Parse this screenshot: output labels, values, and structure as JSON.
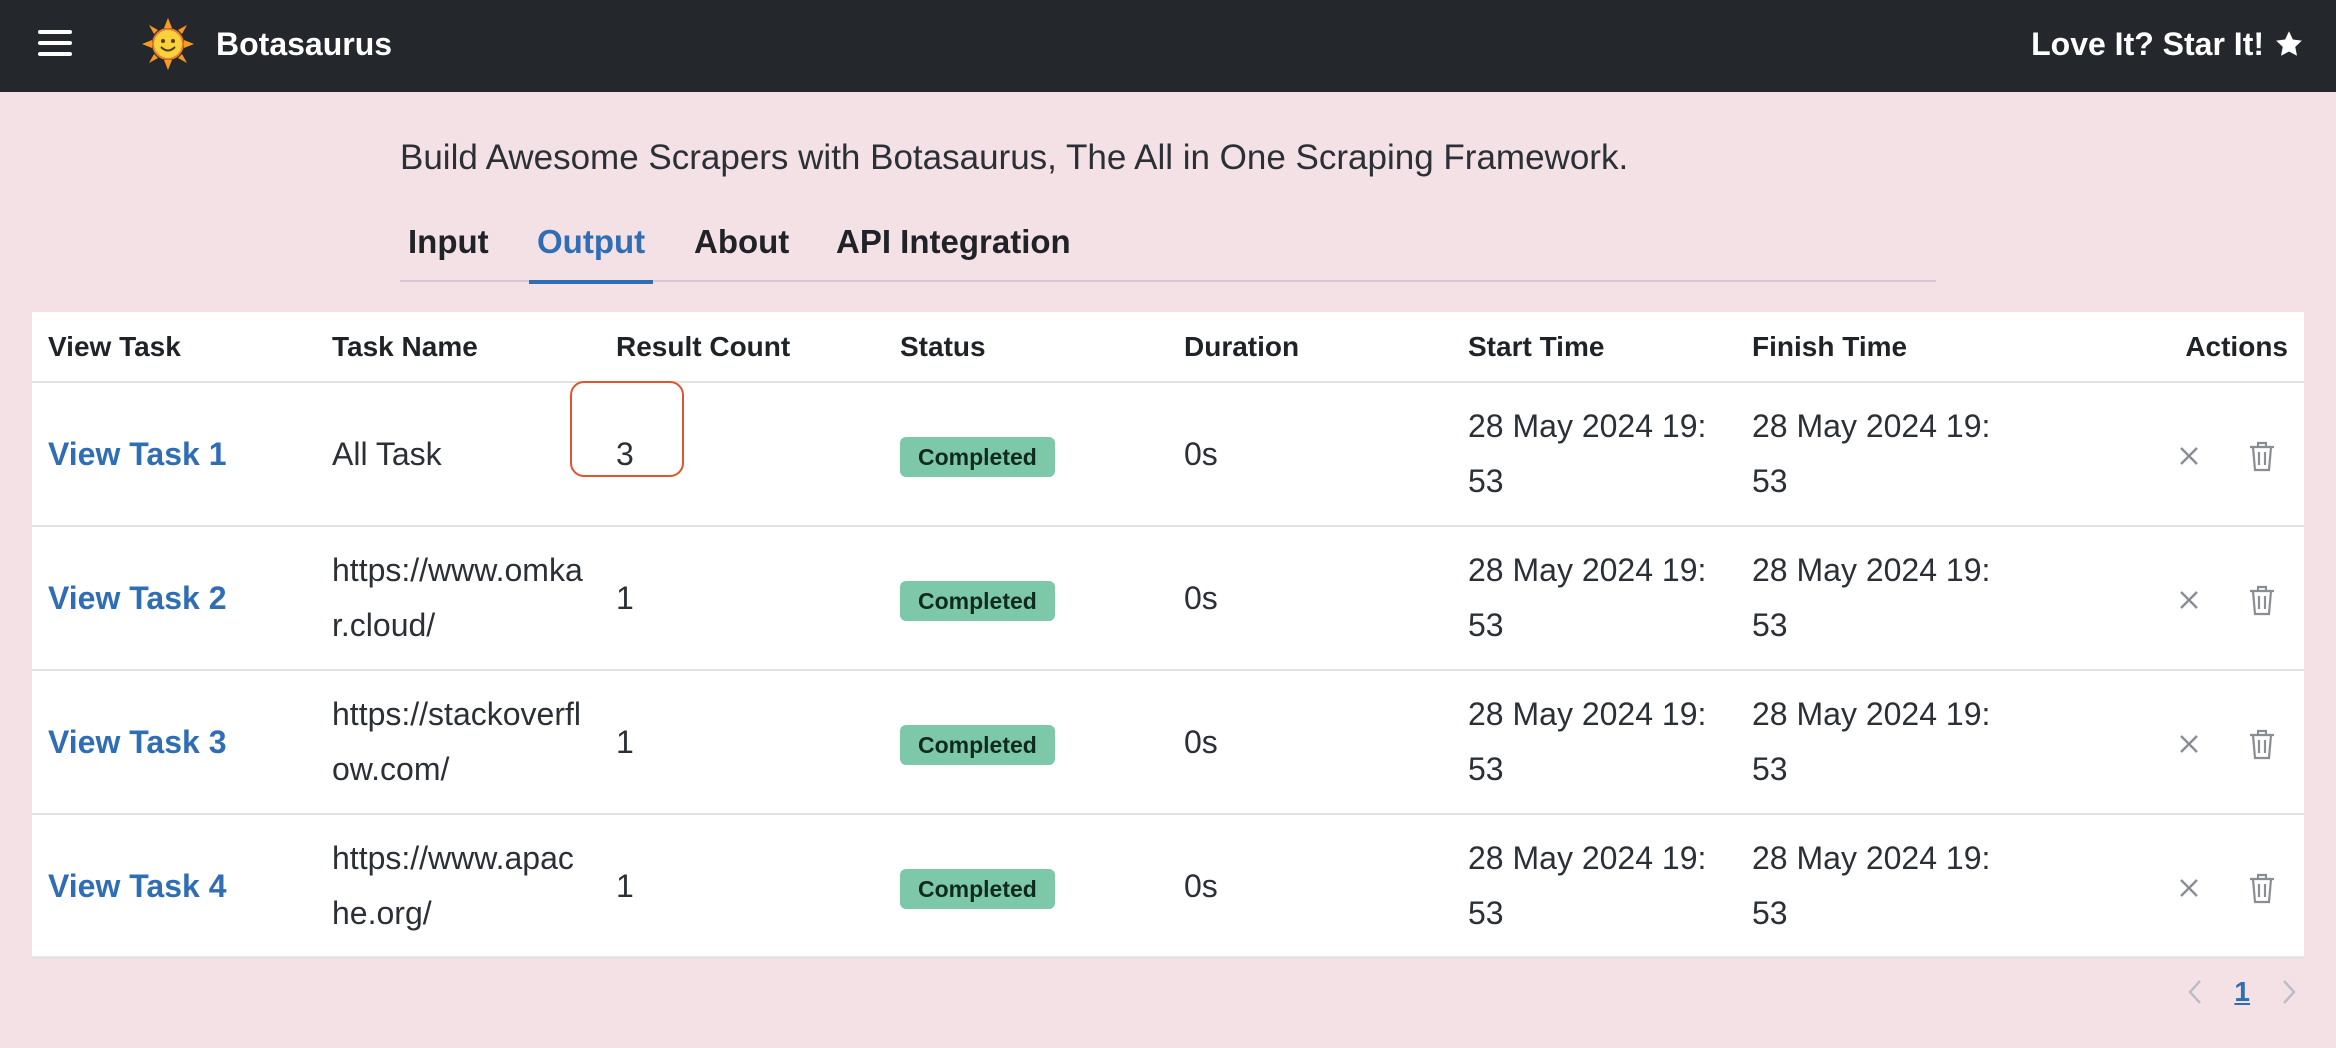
{
  "header": {
    "brand": "Botasaurus",
    "cta": "Love It? Star It!"
  },
  "tagline": "Build Awesome Scrapers with Botasaurus, The All in One Scraping Framework.",
  "tabs": [
    {
      "label": "Input",
      "active": false
    },
    {
      "label": "Output",
      "active": true
    },
    {
      "label": "About",
      "active": false
    },
    {
      "label": "API Integration",
      "active": false
    }
  ],
  "table": {
    "columns": [
      "View Task",
      "Task Name",
      "Result Count",
      "Status",
      "Duration",
      "Start Time",
      "Finish Time",
      "Actions"
    ],
    "rows": [
      {
        "view": "View Task 1",
        "name": "All Task",
        "count": "3",
        "status": "Completed",
        "duration": "0s",
        "start": "28 May 2024 19:53",
        "finish": "28 May 2024 19:53"
      },
      {
        "view": "View Task 2",
        "name": "https://www.omkar.cloud/",
        "count": "1",
        "status": "Completed",
        "duration": "0s",
        "start": "28 May 2024 19:53",
        "finish": "28 May 2024 19:53"
      },
      {
        "view": "View Task 3",
        "name": "https://stackoverflow.com/",
        "count": "1",
        "status": "Completed",
        "duration": "0s",
        "start": "28 May 2024 19:53",
        "finish": "28 May 2024 19:53"
      },
      {
        "view": "View Task 4",
        "name": "https://www.apache.org/",
        "count": "1",
        "status": "Completed",
        "duration": "0s",
        "start": "28 May 2024 19:53",
        "finish": "28 May 2024 19:53"
      }
    ]
  },
  "pagination": {
    "current_page": "1"
  },
  "colors": {
    "accent": "#2f6db5",
    "status_completed": "#7ec8aa",
    "header_bg": "#24272c",
    "page_bg": "#f3e1e6",
    "highlight": "#e0542e"
  },
  "icons": {
    "menu": "hamburger-icon",
    "logo": "sun-logo-icon",
    "star": "star-icon",
    "cancel": "close-icon",
    "delete": "trash-icon",
    "prev": "chevron-left-icon",
    "next": "chevron-right-icon"
  }
}
